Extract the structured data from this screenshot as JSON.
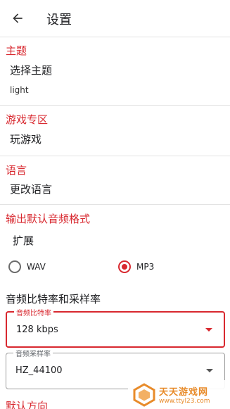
{
  "appbar": {
    "title": "设置"
  },
  "sections": {
    "theme": {
      "title": "主题",
      "item": "选择主题",
      "value": "light"
    },
    "games": {
      "title": "游戏专区",
      "item": "玩游戏"
    },
    "language": {
      "title": "语言",
      "item": "更改语言"
    },
    "output": {
      "title": "输出默认音频格式",
      "item": "扩展"
    }
  },
  "format": {
    "options": [
      {
        "label": "WAV",
        "checked": false
      },
      {
        "label": "MP3",
        "checked": true
      }
    ]
  },
  "rates": {
    "heading": "音频比特率和采样率",
    "bitrate": {
      "label": "音频比特率",
      "value": "128 kbps"
    },
    "samplerate": {
      "label": "音频采样率",
      "value": "HZ_44100"
    }
  },
  "next_section": {
    "title": "默认方向"
  },
  "watermark": {
    "title": "天天游戏网",
    "url": "www.ttyl23.com"
  },
  "colors": {
    "accent": "#d8282f",
    "watermark": "#e88b2a"
  }
}
